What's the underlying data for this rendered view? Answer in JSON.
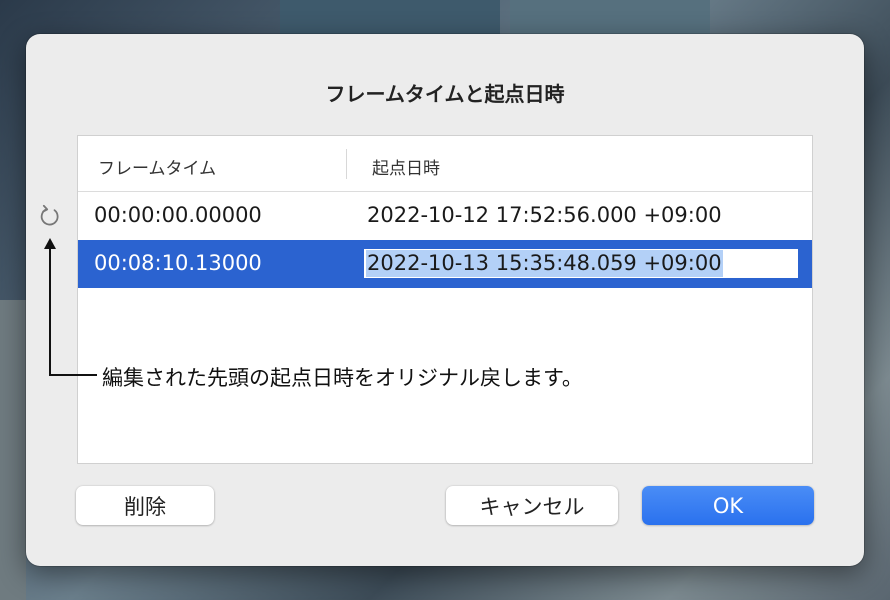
{
  "dialog": {
    "title": "フレームタイムと起点日時"
  },
  "table": {
    "columns": [
      "フレームタイム",
      "起点日時"
    ],
    "rows": [
      {
        "frame_time": "00:00:00.00000",
        "start_datetime": "2022-10-12 17:52:56.000 +09:00",
        "selected": false
      },
      {
        "frame_time": "00:08:10.13000",
        "start_datetime": "2022-10-13 15:35:48.059 +09:00",
        "selected": true
      }
    ]
  },
  "revert": {
    "icon": "revert-icon",
    "annotation": "編集された先頭の起点日時をオリジナル戻します。"
  },
  "buttons": {
    "delete": "削除",
    "cancel": "キャンセル",
    "ok": "OK"
  },
  "colors": {
    "selection": "#2b63d0",
    "primary_button": "#2a71ee",
    "text_selection": "#b3d0f7"
  }
}
